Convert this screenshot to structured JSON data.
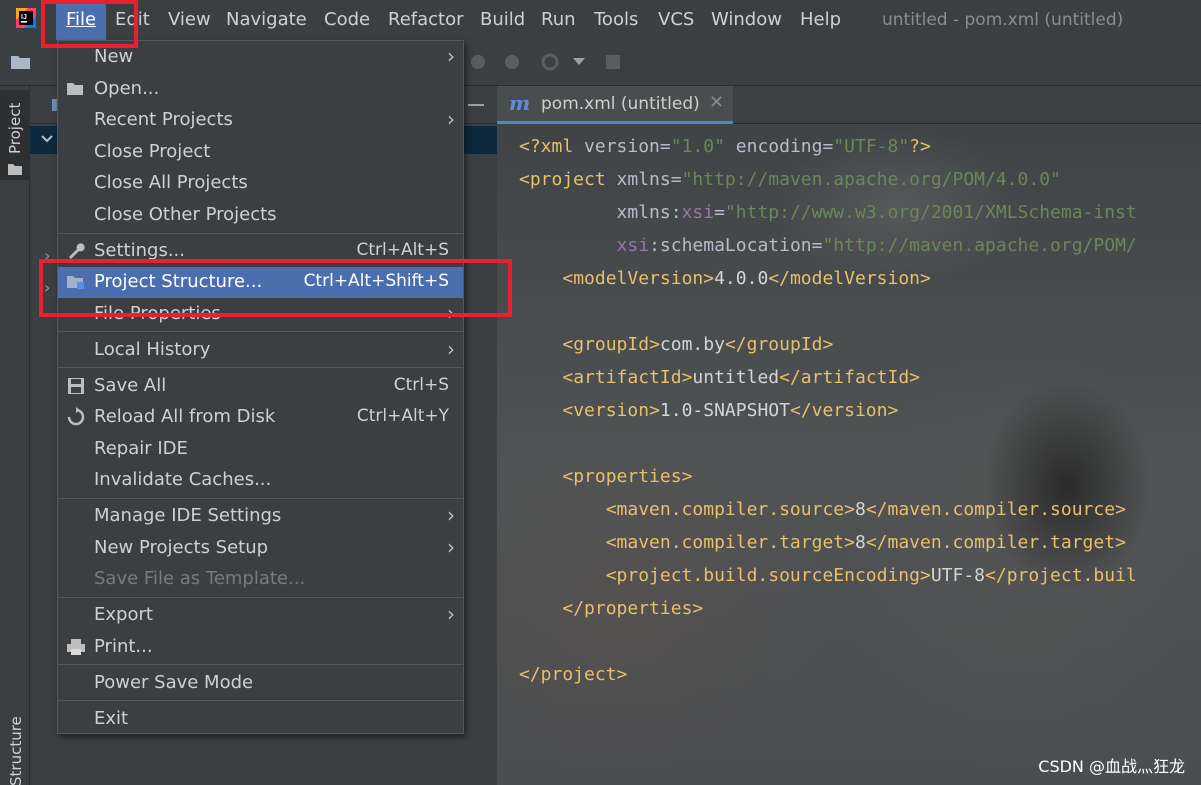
{
  "menubar": {
    "items": [
      {
        "label": "File"
      },
      {
        "label": "Edit"
      },
      {
        "label": "View"
      },
      {
        "label": "Navigate"
      },
      {
        "label": "Code"
      },
      {
        "label": "Refactor"
      },
      {
        "label": "Build"
      },
      {
        "label": "Run"
      },
      {
        "label": "Tools"
      },
      {
        "label": "VCS"
      },
      {
        "label": "Window"
      },
      {
        "label": "Help"
      }
    ],
    "window_title": "untitled - pom.xml (untitled)"
  },
  "left_stripe": {
    "project_label": "Project",
    "structure_label": "Structure"
  },
  "editor": {
    "tab_label": "pom.xml (untitled)",
    "tab_icon_letter": "m",
    "code_lines": [
      "<?xml version=\"1.0\" encoding=\"UTF-8\"?>",
      "<project xmlns=\"http://maven.apache.org/POM/4.0.0\"",
      "         xmlns:xsi=\"http://www.w3.org/2001/XMLSchema-inst",
      "         xsi:schemaLocation=\"http://maven.apache.org/POM/",
      "    <modelVersion>4.0.0</modelVersion>",
      "",
      "    <groupId>com.by</groupId>",
      "    <artifactId>untitled</artifactId>",
      "    <version>1.0-SNAPSHOT</version>",
      "",
      "    <properties>",
      "        <maven.compiler.source>8</maven.compiler.source>",
      "        <maven.compiler.target>8</maven.compiler.target>",
      "        <project.build.sourceEncoding>UTF-8</project.buil",
      "    </properties>",
      "",
      "</project>"
    ]
  },
  "file_menu": {
    "items": [
      {
        "label": "New",
        "submenu": true
      },
      {
        "label": "Open...",
        "icon": "folder-open-icon"
      },
      {
        "label": "Recent Projects",
        "submenu": true
      },
      {
        "label": "Close Project"
      },
      {
        "label": "Close All Projects"
      },
      {
        "label": "Close Other Projects"
      },
      {
        "label": "Settings...",
        "shortcut": "Ctrl+Alt+S",
        "icon": "wrench-icon"
      },
      {
        "label": "Project Structure...",
        "shortcut": "Ctrl+Alt+Shift+S",
        "icon": "project-structure-icon",
        "selected": true
      },
      {
        "label": "File Properties",
        "submenu": true
      },
      {
        "label": "Local History",
        "submenu": true
      },
      {
        "label": "Save All",
        "shortcut": "Ctrl+S",
        "icon": "save-icon"
      },
      {
        "label": "Reload All from Disk",
        "shortcut": "Ctrl+Alt+Y",
        "icon": "reload-icon"
      },
      {
        "label": "Repair IDE"
      },
      {
        "label": "Invalidate Caches..."
      },
      {
        "label": "Manage IDE Settings",
        "submenu": true
      },
      {
        "label": "New Projects Setup",
        "submenu": true
      },
      {
        "label": "Save File as Template...",
        "disabled": true
      },
      {
        "label": "Export",
        "submenu": true
      },
      {
        "label": "Print...",
        "icon": "printer-icon"
      },
      {
        "label": "Power Save Mode"
      },
      {
        "label": "Exit"
      }
    ]
  },
  "watermark": "CSDN @血战灬狂龙",
  "colors": {
    "selection": "#4b6eaf",
    "highlight_box": "#e8212e",
    "xml_tag": "#e8bf6a",
    "xml_string": "#6a8759"
  }
}
